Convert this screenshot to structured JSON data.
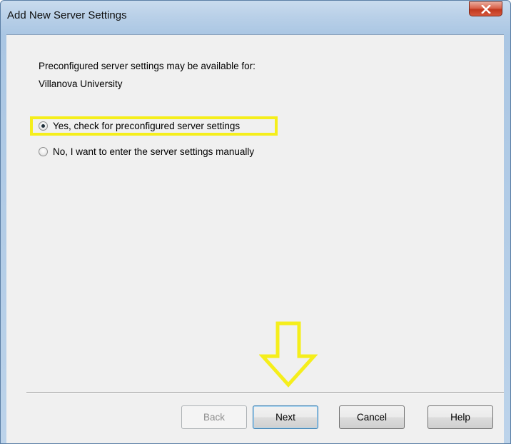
{
  "window": {
    "title": "Add New Server Settings",
    "close_icon": "close-icon"
  },
  "main": {
    "info_line_1": "Preconfigured server settings may be available for:",
    "info_line_2": "Villanova University",
    "options": [
      {
        "label": "Yes, check for preconfigured server settings",
        "selected": true
      },
      {
        "label": "No, I want to enter the server settings manually",
        "selected": false
      }
    ],
    "annotation": {
      "highlight_color": "#f5ee1b",
      "arrow_icon": "down-arrow-icon"
    }
  },
  "buttons": {
    "back": {
      "label": "Back",
      "enabled": false
    },
    "next": {
      "label": "Next",
      "enabled": true
    },
    "cancel": {
      "label": "Cancel",
      "enabled": true
    },
    "help": {
      "label": "Help",
      "enabled": true
    }
  },
  "colors": {
    "title_bar": "#b9d0e8",
    "client_bg": "#f0f0f0",
    "close_button": "#c0381e"
  }
}
